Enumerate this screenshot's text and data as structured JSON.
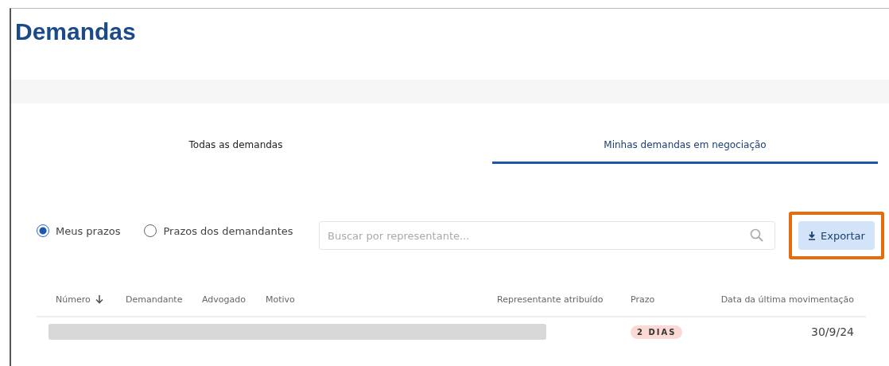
{
  "page": {
    "title": "Demandas"
  },
  "tabs": [
    {
      "label": "Todas as demandas",
      "selected": false
    },
    {
      "label": "Minhas demandas em negociação",
      "selected": true
    }
  ],
  "filters": [
    {
      "label": "Meus prazos",
      "selected": true
    },
    {
      "label": "Prazos dos demandantes",
      "selected": false
    }
  ],
  "search": {
    "placeholder": "Buscar por representante..."
  },
  "export_button": {
    "label": "Exportar",
    "highlighted": true
  },
  "table": {
    "columns": [
      {
        "label": "Número",
        "sorted": true
      },
      {
        "label": "Demandante",
        "sorted": false
      },
      {
        "label": "Advogado",
        "sorted": false
      },
      {
        "label": "Motivo",
        "sorted": false
      },
      {
        "label": "Representante atribuído",
        "sorted": false
      },
      {
        "label": "Prazo",
        "sorted": false
      },
      {
        "label": "Data da última movimentação",
        "sorted": false
      }
    ],
    "rows": [
      {
        "redacted": true,
        "deadline": "2 DIAS",
        "last_update": "30/9/24"
      }
    ]
  }
}
